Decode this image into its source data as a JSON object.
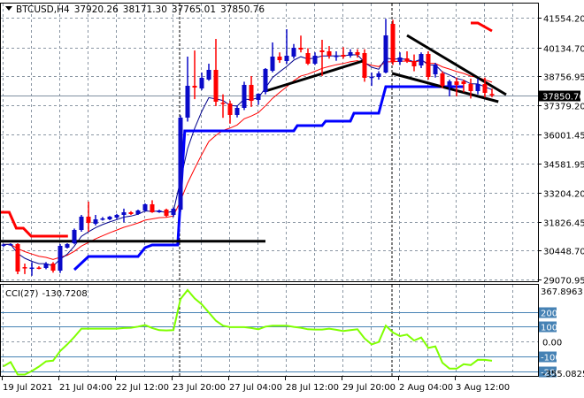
{
  "header": {
    "symbol": "BTCUSD,H4",
    "open": "37920.26",
    "high": "38171.30",
    "low": "37765.01",
    "close": "37850.76"
  },
  "cci_label": {
    "name": "CCI(27)",
    "value": "-130.7208"
  },
  "colors": {
    "bull": "#0a0ac8",
    "bear": "#ff0000",
    "fast_ma": "#00008b",
    "slow_ma": "#ff0000",
    "support_step": "#0000ff",
    "resist_step": "#ff0000",
    "cci": "#7fff00",
    "cci_levels": "#4682b4",
    "grid": "#8a96a3",
    "trendline": "#000000"
  },
  "chart_data": {
    "type": "candlestick",
    "title": "BTCUSD,H4",
    "price_axis": {
      "range": [
        29070.95,
        41554.2
      ],
      "ticks": [
        "41554.20",
        "40134.70",
        "38756.95",
        "37379.20",
        "36001.45",
        "34581.95",
        "33204.20",
        "31826.45",
        "30448.70",
        "29070.95"
      ]
    },
    "current_price": "37850.76",
    "time_labels": [
      {
        "index": 0,
        "label": "19 Jul 2021"
      },
      {
        "index": 8,
        "label": "21 Jul 04:00"
      },
      {
        "index": 16,
        "label": "22 Jul 12:00"
      },
      {
        "index": 24,
        "label": "23 Jul 20:00"
      },
      {
        "index": 32,
        "label": "27 Jul 04:00"
      },
      {
        "index": 40,
        "label": "28 Jul 12:00"
      },
      {
        "index": 48,
        "label": "29 Jul 20:00"
      },
      {
        "index": 56,
        "label": "2 Aug 04:00"
      },
      {
        "index": 64,
        "label": "3 Aug 12:00"
      }
    ],
    "separators": [
      25,
      55
    ],
    "candles": [
      [
        30700,
        30780,
        30620,
        30740
      ],
      [
        30740,
        30800,
        30680,
        30760
      ],
      [
        30759,
        30800,
        29325,
        29452
      ],
      [
        29660,
        29830,
        29330,
        29620
      ],
      [
        29600,
        29900,
        29250,
        29640
      ],
      [
        29640,
        29700,
        29560,
        29610
      ],
      [
        29620,
        29900,
        29560,
        29831
      ],
      [
        29831,
        29900,
        29400,
        29494
      ],
      [
        29494,
        30760,
        29380,
        30675
      ],
      [
        30590,
        30800,
        30550,
        30759
      ],
      [
        30801,
        31500,
        30750,
        31434
      ],
      [
        31434,
        32150,
        31350,
        32067
      ],
      [
        32067,
        32783,
        31349,
        31771
      ],
      [
        31729,
        32150,
        31650,
        31940
      ],
      [
        31960,
        32050,
        31880,
        31982
      ],
      [
        31940,
        32100,
        31900,
        32067
      ],
      [
        32024,
        32200,
        31950,
        32151
      ],
      [
        32151,
        32450,
        31800,
        32277
      ],
      [
        32277,
        32330,
        32150,
        32193
      ],
      [
        32193,
        32400,
        32150,
        32362
      ],
      [
        32362,
        32700,
        32300,
        32657
      ],
      [
        32657,
        32850,
        32250,
        32277
      ],
      [
        32277,
        32400,
        32250,
        32362
      ],
      [
        32404,
        32450,
        32050,
        32109
      ],
      [
        32151,
        32500,
        32050,
        32446
      ],
      [
        32400,
        36900,
        32300,
        36789
      ],
      [
        36789,
        39699,
        36600,
        38307
      ],
      [
        38307,
        39990,
        37670,
        38223
      ],
      [
        38181,
        38940,
        38100,
        38687
      ],
      [
        38603,
        39360,
        38550,
        39066
      ],
      [
        39066,
        40542,
        37340,
        37548
      ],
      [
        37500,
        37900,
        36780,
        37464
      ],
      [
        37464,
        37600,
        36500,
        36916
      ],
      [
        36916,
        37380,
        36800,
        37253
      ],
      [
        37253,
        38500,
        37150,
        38350
      ],
      [
        38350,
        38771,
        37300,
        37591
      ],
      [
        37633,
        37950,
        37400,
        37928
      ],
      [
        38012,
        39150,
        37900,
        39109
      ],
      [
        39024,
        40374,
        38950,
        39699
      ],
      [
        39699,
        39900,
        39400,
        39530
      ],
      [
        39488,
        41005,
        39350,
        39741
      ],
      [
        39699,
        40300,
        39600,
        40120
      ],
      [
        40120,
        40700,
        39900,
        40035
      ],
      [
        39867,
        40100,
        39300,
        39361
      ],
      [
        39361,
        39900,
        39300,
        39741
      ],
      [
        39994,
        40500,
        38771,
        39910
      ],
      [
        39952,
        40200,
        39600,
        39741
      ],
      [
        39720,
        39950,
        39500,
        39741
      ],
      [
        39783,
        40150,
        39600,
        39699
      ],
      [
        39741,
        40050,
        39650,
        39910
      ],
      [
        39910,
        40050,
        39650,
        39783
      ],
      [
        39867,
        40050,
        38500,
        38687
      ],
      [
        38729,
        38940,
        38300,
        38740
      ],
      [
        38729,
        39000,
        38600,
        38898
      ],
      [
        38940,
        41500,
        38900,
        40711
      ],
      [
        41259,
        41450,
        39300,
        39446
      ],
      [
        39446,
        39900,
        39300,
        39657
      ],
      [
        39615,
        39950,
        39400,
        39488
      ],
      [
        39488,
        39800,
        39000,
        39235
      ],
      [
        39277,
        39900,
        39150,
        39825
      ],
      [
        39825,
        39950,
        38600,
        38729
      ],
      [
        38856,
        39400,
        38700,
        39319
      ],
      [
        38898,
        39000,
        38200,
        38307
      ],
      [
        38265,
        38600,
        37800,
        38518
      ],
      [
        38518,
        38700,
        37800,
        38350
      ],
      [
        38518,
        38600,
        38000,
        38392
      ],
      [
        38392,
        38650,
        37700,
        38054
      ],
      [
        38054,
        38650,
        37900,
        38392
      ],
      [
        38392,
        38700,
        37750,
        37970
      ],
      [
        37920.26,
        38171.3,
        37765.01,
        37850.76
      ]
    ],
    "indicators": {
      "support_step": [
        [
          10,
          29536
        ],
        [
          12,
          30168
        ],
        [
          19,
          30168
        ],
        [
          20,
          30590
        ],
        [
          21,
          30716
        ],
        [
          24.6,
          30716
        ],
        [
          25.6,
          36156
        ],
        [
          41,
          36156
        ],
        [
          41.5,
          36410
        ],
        [
          45,
          36410
        ],
        [
          45.5,
          36620
        ],
        [
          49,
          36620
        ],
        [
          49.5,
          36998
        ],
        [
          53,
          36998
        ],
        [
          54,
          38265
        ],
        [
          65,
          38265
        ]
      ],
      "resist_step": [
        [
          [
            -0.5,
            32277
          ],
          [
            0.8,
            32277
          ],
          [
            1.8,
            31518
          ],
          [
            2.8,
            31518
          ],
          [
            3.9,
            31138
          ],
          [
            9.1,
            31138
          ]
        ],
        [
          [
            66,
            41301
          ],
          [
            67,
            41301
          ],
          [
            69,
            40922
          ]
        ]
      ],
      "horizontal_level": {
        "price": 30898,
        "from": -0.5,
        "to": 37
      },
      "trendlines": [
        [
          [
            37,
            38054
          ],
          [
            50.75,
            39488
          ]
        ],
        [
          [
            57,
            40711
          ],
          [
            71,
            37886
          ]
        ],
        [
          [
            54.9,
            38898
          ],
          [
            69.9,
            37548
          ]
        ]
      ]
    },
    "cci": {
      "period": 27,
      "values": [
        -168,
        -140,
        -224,
        -224,
        -200,
        -170,
        -135,
        -130,
        -65,
        -20,
        30,
        86,
        86,
        86,
        86,
        86,
        86,
        90,
        92,
        100,
        110,
        90,
        76,
        74,
        76,
        286,
        346,
        290,
        250,
        195,
        140,
        106,
        96,
        96,
        96,
        90,
        82,
        100,
        106,
        106,
        106,
        98,
        92,
        82,
        80,
        80,
        86,
        78,
        70,
        76,
        82,
        20,
        -20,
        -4,
        106,
        60,
        36,
        46,
        6,
        26,
        -44,
        -34,
        -144,
        -184,
        -184,
        -154,
        -160,
        -124,
        -125,
        -130.72
      ],
      "levels": [
        200,
        100,
        -100,
        -200
      ],
      "level_labels": [
        "200",
        "100",
        "-100",
        "-200"
      ],
      "axis_max": "367.8963",
      "axis_zero": "0.00",
      "axis_min": "-355.0825"
    }
  }
}
